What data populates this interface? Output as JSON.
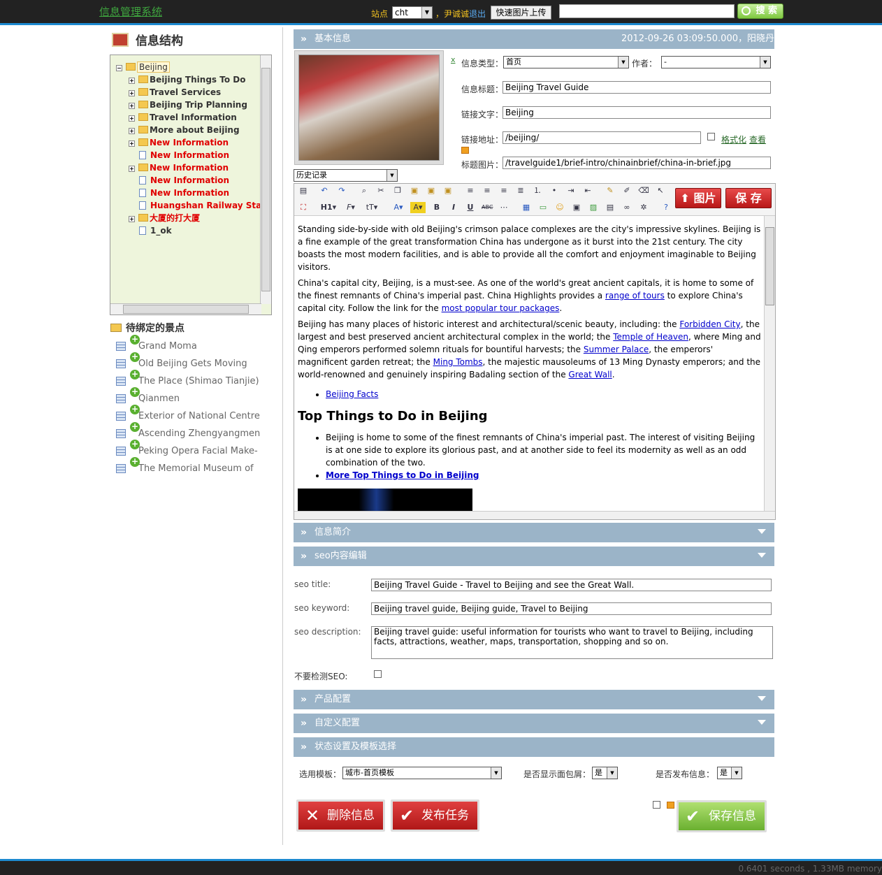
{
  "header": {
    "app_title": "信息管理系统",
    "site_label": "站点",
    "site_value": "cht",
    "user": "，尹诚诚",
    "logout": "退出",
    "upload": "快速图片上传",
    "search_value": "",
    "search_button": "搜 索"
  },
  "sidebar": {
    "title": "信息结构",
    "tree": [
      {
        "label": "Beijing",
        "expander": "−",
        "kind": "folder",
        "red": false
      },
      {
        "label": "Beijing Things To Do",
        "expander": "+",
        "kind": "folder",
        "red": false
      },
      {
        "label": "Travel Services",
        "expander": "+",
        "kind": "folder",
        "red": false
      },
      {
        "label": "Beijing Trip Planning",
        "expander": "+",
        "kind": "folder",
        "red": false
      },
      {
        "label": "Travel Information",
        "expander": "+",
        "kind": "folder",
        "red": false
      },
      {
        "label": "More about Beijing",
        "expander": "+",
        "kind": "folder",
        "red": false
      },
      {
        "label": "New Information",
        "expander": "+",
        "kind": "folder",
        "red": true
      },
      {
        "label": "New Information",
        "expander": "",
        "kind": "page",
        "red": true
      },
      {
        "label": "New Information",
        "expander": "+",
        "kind": "folder",
        "red": true
      },
      {
        "label": "New Information",
        "expander": "",
        "kind": "page",
        "red": true
      },
      {
        "label": "New Information",
        "expander": "",
        "kind": "page",
        "red": true
      },
      {
        "label": "Huangshan Railway Sta",
        "expander": "",
        "kind": "page",
        "red": true
      },
      {
        "label": "大厦的打大厦",
        "expander": "+",
        "kind": "folder",
        "red": true
      },
      {
        "label": "1_ok",
        "expander": "",
        "kind": "page",
        "red": false
      }
    ],
    "pending_title": "待绑定的景点",
    "pending": [
      "Grand Moma",
      "Old Beijing Gets Moving",
      "The Place (Shimao Tianjie)",
      "Qianmen",
      "Exterior of National Centre",
      "Ascending Zhengyangmen",
      "Peking Opera Facial Make-",
      "The Memorial Museum of"
    ]
  },
  "basic": {
    "bar_title": "基本信息",
    "timestamp": "2012-09-26 03:09:50.000，阳晓丹",
    "remove": "x",
    "type_label": "信息类型：",
    "type_value": "首页",
    "author_label": "作者：",
    "author_value": "-",
    "title_label": "信息标题：",
    "title_value": "Beijing Travel Guide",
    "linktext_label": "链接文字：",
    "linktext_value": "Beijing",
    "url_label": "链接地址：",
    "url_value": "/beijing/",
    "format_link": "格式化",
    "view_link": "查看",
    "image_label": "标题图片：",
    "image_value": "/travelguide1/brief-intro/chinainbrief/china-in-brief.jpg",
    "history_value": "历史记录"
  },
  "editor": {
    "image_button": "图片",
    "save_button": "保 存",
    "p1": "Standing side-by-side with old Beijing's crimson palace complexes are the city's impressive skylines. Beijing is a fine example of the great transformation China has undergone as it burst into the 21st century. The city boasts the most modern facilities, and is able to provide all the comfort and enjoyment imaginable to Beijing visitors.",
    "p2_a": "China's capital city, Beijing, is a must-see. As one of the world's great ancient capitals, it is home to some of the finest remnants of China's imperial past. China Highlights provides a ",
    "p2_link1": "range of tours",
    "p2_b": " to explore China's capital city. Follow the link for the ",
    "p2_link2": "most popular tour packages",
    "p2_c": ".",
    "p3_a": "Beijing has many places of historic interest and architectural/scenic beauty, including: the ",
    "p3_l1": "Forbidden City",
    "p3_b": ", the largest and best preserved ancient architectural complex in the world; the ",
    "p3_l2": "Temple of Heaven",
    "p3_c": ", where Ming and Qing emperors performed solemn rituals for bountiful harvests; the ",
    "p3_l3": "Summer Palace",
    "p3_d": ", the emperors' magnificent garden retreat; the ",
    "p3_l4": "Ming Tombs",
    "p3_e": ", the majestic mausoleums of 13 Ming Dynasty emperors; and the world-renowned and genuinely inspiring Badaling section of the ",
    "p3_l5": "Great Wall",
    "p3_f": ".",
    "facts_link": "Beijing Facts",
    "heading": "Top Things to Do in Beijing",
    "bullet": "Beijing is home to some of the finest remnants of China's imperial past. The interest of visiting Beijing is at one side to explore its glorious past, and at another side to feel its modernity as well as an odd combination of the two.",
    "more_link": "More Top Things to Do in Beijing"
  },
  "sections": {
    "summary": "信息简介",
    "seo": "seo内容编辑",
    "product": "产品配置",
    "custom": "自定义配置",
    "status": "状态设置及模板选择"
  },
  "seo": {
    "title_label": "seo title:",
    "title_value": "Beijing Travel Guide - Travel to Beijing and see the Great Wall.",
    "keyword_label": "seo keyword:",
    "keyword_value": "Beijing travel guide, Beijing guide, Travel to Beijing",
    "desc_label": "seo description:",
    "desc_value": "Beijing travel guide: useful information for tourists who want to travel to Beijing, including facts, attractions, weather, maps, transportation, shopping and so on.",
    "nocheck_label": "不要检测SEO:"
  },
  "template": {
    "label": "选用模板：",
    "value": "城市-首页模板",
    "crumb_label": "是否显示面包屑：",
    "crumb_value": "是",
    "publish_label": "是否发布信息：",
    "publish_value": "是"
  },
  "actions": {
    "delete": "删除信息",
    "publish": "发布任务",
    "save": "保存信息"
  },
  "footer": {
    "stats": "0.6401 seconds , 1.33MB memory"
  },
  "colors": {
    "accent": "#1d8ad0",
    "section_bar": "#9bb4c8",
    "danger": "#c82020",
    "success": "#7cc040"
  }
}
